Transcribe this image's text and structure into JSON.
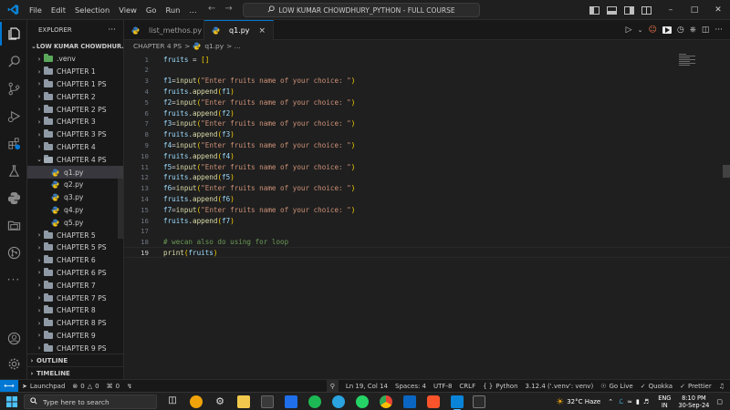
{
  "menu": [
    "File",
    "Edit",
    "Selection",
    "View",
    "Go",
    "Run",
    "…"
  ],
  "search": {
    "text": "LOW KUMAR CHOWDHURY_PYTHON - FULL COURSE"
  },
  "window_controls": {
    "minimize": "–",
    "maximize": "□",
    "close": "✕"
  },
  "explorer": {
    "title": "EXPLORER",
    "more": "···",
    "root": "LOW KUMAR CHOWDHUR...",
    "items": [
      {
        "label": ".venv",
        "type": "venv"
      },
      {
        "label": "CHAPTER 1",
        "type": "folder"
      },
      {
        "label": "CHAPTER 1 PS",
        "type": "folder"
      },
      {
        "label": "CHAPTER 2",
        "type": "folder"
      },
      {
        "label": "CHAPTER 2 PS",
        "type": "folder"
      },
      {
        "label": "CHAPTER 3",
        "type": "folder"
      },
      {
        "label": "CHAPTER 3 PS",
        "type": "folder"
      },
      {
        "label": "CHAPTER 4",
        "type": "folder"
      },
      {
        "label": "CHAPTER 4 PS",
        "type": "open"
      },
      {
        "label": "q1.py",
        "type": "file",
        "selected": true
      },
      {
        "label": "q2.py",
        "type": "file"
      },
      {
        "label": "q3.py",
        "type": "file"
      },
      {
        "label": "q4.py",
        "type": "file"
      },
      {
        "label": "q5.py",
        "type": "file"
      },
      {
        "label": "CHAPTER 5",
        "type": "folder"
      },
      {
        "label": "CHAPTER 5 PS",
        "type": "folder"
      },
      {
        "label": "CHAPTER 6",
        "type": "folder"
      },
      {
        "label": "CHAPTER 6 PS",
        "type": "folder"
      },
      {
        "label": "CHAPTER 7",
        "type": "folder"
      },
      {
        "label": "CHAPTER 7 PS",
        "type": "folder"
      },
      {
        "label": "CHAPTER 8",
        "type": "folder"
      },
      {
        "label": "CHAPTER 8 PS",
        "type": "folder"
      },
      {
        "label": "CHAPTER 9",
        "type": "folder"
      },
      {
        "label": "CHAPTER 9 PS",
        "type": "folder"
      }
    ],
    "outline": "OUTLINE",
    "timeline": "TIMELINE"
  },
  "tabs": [
    {
      "label": "list_methos.py",
      "active": false
    },
    {
      "label": "q1.py",
      "active": true,
      "close": "×"
    }
  ],
  "breadcrumb": {
    "folder": "CHAPTER 4 PS",
    "sep": ">",
    "file": "q1.py",
    "rest": "> ..."
  },
  "code": [
    {
      "n": "1",
      "tokens": [
        [
          "var",
          "fruits"
        ],
        [
          "punc",
          " = "
        ],
        [
          "br1",
          "[]"
        ]
      ]
    },
    {
      "n": "2",
      "tokens": []
    },
    {
      "n": "3",
      "tokens": [
        [
          "var",
          "f1"
        ],
        [
          "punc",
          "="
        ],
        [
          "fn",
          "input"
        ],
        [
          "br1",
          "("
        ],
        [
          "str",
          "\"Enter fruits name of your choice: \""
        ],
        [
          "br1",
          ")"
        ]
      ]
    },
    {
      "n": "4",
      "tokens": [
        [
          "var",
          "fruits"
        ],
        [
          "punc",
          "."
        ],
        [
          "fn",
          "append"
        ],
        [
          "br1",
          "("
        ],
        [
          "var",
          "f1"
        ],
        [
          "br1",
          ")"
        ]
      ]
    },
    {
      "n": "5",
      "tokens": [
        [
          "var",
          "f2"
        ],
        [
          "punc",
          "="
        ],
        [
          "fn",
          "input"
        ],
        [
          "br1",
          "("
        ],
        [
          "str",
          "\"Enter fruits name of your choice: \""
        ],
        [
          "br1",
          ")"
        ]
      ]
    },
    {
      "n": "6",
      "tokens": [
        [
          "var",
          "fruits"
        ],
        [
          "punc",
          "."
        ],
        [
          "fn",
          "append"
        ],
        [
          "br1",
          "("
        ],
        [
          "var",
          "f2"
        ],
        [
          "br1",
          ")"
        ]
      ]
    },
    {
      "n": "7",
      "tokens": [
        [
          "var",
          "f3"
        ],
        [
          "punc",
          "="
        ],
        [
          "fn",
          "input"
        ],
        [
          "br1",
          "("
        ],
        [
          "str",
          "\"Enter fruits name of your choice: \""
        ],
        [
          "br1",
          ")"
        ]
      ]
    },
    {
      "n": "8",
      "tokens": [
        [
          "var",
          "fruits"
        ],
        [
          "punc",
          "."
        ],
        [
          "fn",
          "append"
        ],
        [
          "br1",
          "("
        ],
        [
          "var",
          "f3"
        ],
        [
          "br1",
          ")"
        ]
      ]
    },
    {
      "n": "9",
      "tokens": [
        [
          "var",
          "f4"
        ],
        [
          "punc",
          "="
        ],
        [
          "fn",
          "input"
        ],
        [
          "br1",
          "("
        ],
        [
          "str",
          "\"Enter fruits name of your choice: \""
        ],
        [
          "br1",
          ")"
        ]
      ]
    },
    {
      "n": "10",
      "tokens": [
        [
          "var",
          "fruits"
        ],
        [
          "punc",
          "."
        ],
        [
          "fn",
          "append"
        ],
        [
          "br1",
          "("
        ],
        [
          "var",
          "f4"
        ],
        [
          "br1",
          ")"
        ]
      ]
    },
    {
      "n": "11",
      "tokens": [
        [
          "var",
          "f5"
        ],
        [
          "punc",
          "="
        ],
        [
          "fn",
          "input"
        ],
        [
          "br1",
          "("
        ],
        [
          "str",
          "\"Enter fruits name of your choice: \""
        ],
        [
          "br1",
          ")"
        ]
      ]
    },
    {
      "n": "12",
      "tokens": [
        [
          "var",
          "fruits"
        ],
        [
          "punc",
          "."
        ],
        [
          "fn",
          "append"
        ],
        [
          "br1",
          "("
        ],
        [
          "var",
          "f5"
        ],
        [
          "br1",
          ")"
        ]
      ]
    },
    {
      "n": "13",
      "tokens": [
        [
          "var",
          "f6"
        ],
        [
          "punc",
          "="
        ],
        [
          "fn",
          "input"
        ],
        [
          "br1",
          "("
        ],
        [
          "str",
          "\"Enter fruits name of your choice: \""
        ],
        [
          "br1",
          ")"
        ]
      ]
    },
    {
      "n": "14",
      "tokens": [
        [
          "var",
          "fruits"
        ],
        [
          "punc",
          "."
        ],
        [
          "fn",
          "append"
        ],
        [
          "br1",
          "("
        ],
        [
          "var",
          "f6"
        ],
        [
          "br1",
          ")"
        ]
      ]
    },
    {
      "n": "15",
      "tokens": [
        [
          "var",
          "f7"
        ],
        [
          "punc",
          "="
        ],
        [
          "fn",
          "input"
        ],
        [
          "br1",
          "("
        ],
        [
          "str",
          "\"Enter fruits name of your choice: \""
        ],
        [
          "br1",
          ")"
        ]
      ]
    },
    {
      "n": "16",
      "tokens": [
        [
          "var",
          "fruits"
        ],
        [
          "punc",
          "."
        ],
        [
          "fn",
          "append"
        ],
        [
          "br1",
          "("
        ],
        [
          "var",
          "f7"
        ],
        [
          "br1",
          ")"
        ]
      ]
    },
    {
      "n": "17",
      "tokens": []
    },
    {
      "n": "18",
      "tokens": [
        [
          "cm",
          "# wecan also do using for loop"
        ]
      ]
    },
    {
      "n": "19",
      "tokens": [
        [
          "fn",
          "print"
        ],
        [
          "br1",
          "("
        ],
        [
          "var",
          "fruits"
        ],
        [
          "br1",
          ")"
        ]
      ],
      "current": true
    }
  ],
  "status": {
    "launchpad": "Launchpad",
    "errors": "0",
    "warnings": "0",
    "ports": "0",
    "position": "Ln 19, Col 14",
    "spaces": "Spaces: 4",
    "encoding": "UTF-8",
    "eol": "CRLF",
    "lang_braces": "{ }",
    "language": "Python",
    "interpreter": "3.12.4 ('.venv': venv)",
    "golive": "Go Live",
    "quokka": "Quokka",
    "prettier": "Prettier"
  },
  "taskbar": {
    "search_placeholder": "Type here to search",
    "weather": "32°C  Haze",
    "lang1": "ENG",
    "lang2": "IN",
    "time": "8:10 PM",
    "date": "30-Sep-24"
  },
  "colors": {
    "accent": "#0078d4",
    "editor_bg": "#1f1f1f",
    "sidebar_bg": "#181818"
  }
}
